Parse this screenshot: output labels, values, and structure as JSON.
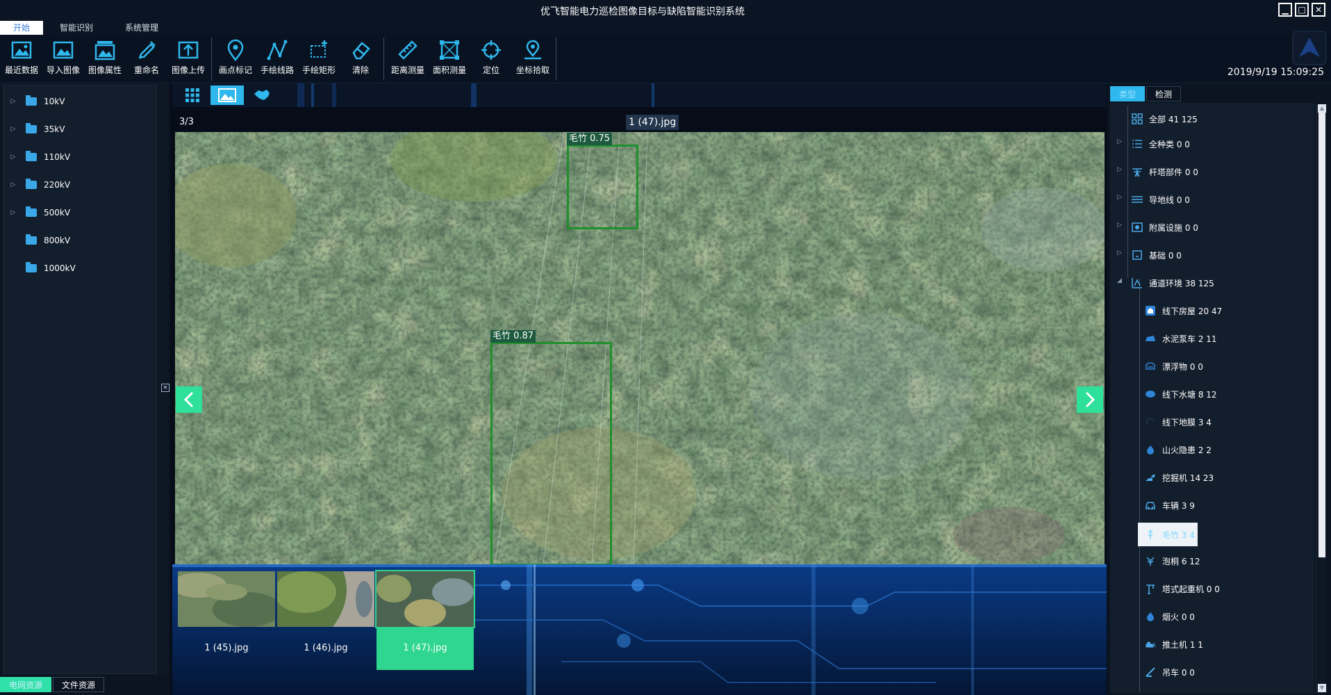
{
  "window": {
    "title": "优飞智能电力巡检图像目标与缺陷智能识别系统",
    "min": "▁",
    "max": "□",
    "close": "✕"
  },
  "menu_tabs": [
    {
      "label": "开始"
    },
    {
      "label": "智能识别"
    },
    {
      "label": "系统管理"
    }
  ],
  "ribbon": [
    {
      "label": "最近数据",
      "icon": "recent-data-icon"
    },
    {
      "label": "导入图像",
      "icon": "import-image-icon"
    },
    {
      "label": "图像属性",
      "icon": "image-properties-icon"
    },
    {
      "label": "重命名",
      "icon": "rename-icon"
    },
    {
      "label": "图像上传",
      "icon": "upload-icon"
    },
    {
      "label": "画点标记",
      "icon": "point-mark-icon"
    },
    {
      "label": "手绘线路",
      "icon": "draw-line-icon"
    },
    {
      "label": "手绘矩形",
      "icon": "draw-rect-icon"
    },
    {
      "label": "清除",
      "icon": "eraser-icon"
    },
    {
      "label": "距离测量",
      "icon": "ruler-icon"
    },
    {
      "label": "面积测量",
      "icon": "area-icon"
    },
    {
      "label": "定位",
      "icon": "crosshair-icon"
    },
    {
      "label": "坐标拾取",
      "icon": "coordinate-pick-icon"
    }
  ],
  "datetime": "2019/9/19 15:09:25",
  "voltage_tree": [
    {
      "label": "10kV",
      "expandable": true
    },
    {
      "label": "35kV",
      "expandable": true
    },
    {
      "label": "110kV",
      "expandable": true
    },
    {
      "label": "220kV",
      "expandable": true
    },
    {
      "label": "500kV",
      "expandable": true
    },
    {
      "label": "800kV",
      "expandable": false
    },
    {
      "label": "1000kV",
      "expandable": false
    }
  ],
  "left_bottom_tabs": [
    {
      "label": "电网资源"
    },
    {
      "label": "文件资源"
    }
  ],
  "viewer": {
    "page_info": "3/3",
    "filename": "1 (47).jpg",
    "detections": [
      {
        "label": "毛竹 0.75",
        "confidence": 0.75
      },
      {
        "label": "毛竹 0.87",
        "confidence": 0.87
      }
    ]
  },
  "thumbnails": [
    {
      "label": "1 (45).jpg"
    },
    {
      "label": "1 (46).jpg"
    },
    {
      "label": "1 (47).jpg",
      "selected": true
    }
  ],
  "right_tabs": [
    {
      "label": "类型"
    },
    {
      "label": "检测"
    }
  ],
  "categories": [
    {
      "label": "全部 41 125",
      "icon": "grid-icon",
      "level": 0
    },
    {
      "label": "全种类 0 0",
      "icon": "list-icon",
      "level": 0
    },
    {
      "label": "杆塔部件 0 0",
      "icon": "tower-part-icon",
      "level": 0
    },
    {
      "label": "导地线 0 0",
      "icon": "wire-icon",
      "level": 0
    },
    {
      "label": "附属设施 0 0",
      "icon": "facility-icon",
      "level": 0
    },
    {
      "label": "基础 0 0",
      "icon": "foundation-icon",
      "level": 0
    },
    {
      "label": "通道环境 38 125",
      "icon": "channel-env-icon",
      "level": 0,
      "expanded": true
    },
    {
      "label": "线下房屋 20 47",
      "icon": "house-icon",
      "level": 1
    },
    {
      "label": "水泥泵车 2 11",
      "icon": "pump-truck-icon",
      "level": 1
    },
    {
      "label": "漂浮物 0 0",
      "icon": "floater-icon",
      "level": 1
    },
    {
      "label": "线下水塘 8 12",
      "icon": "pond-icon",
      "level": 1
    },
    {
      "label": "线下地膜 3 4",
      "icon": "film-icon",
      "level": 1
    },
    {
      "label": "山火隐患 2 2",
      "icon": "fire-icon",
      "level": 1
    },
    {
      "label": "挖掘机 14 23",
      "icon": "excavator-icon",
      "level": 1
    },
    {
      "label": "车辆 3 9",
      "icon": "vehicle-icon",
      "level": 1
    },
    {
      "label": "毛竹 3 4",
      "icon": "bamboo-icon",
      "level": 1,
      "selected": true
    },
    {
      "label": "泡桐 6 12",
      "icon": "tree-icon",
      "level": 1
    },
    {
      "label": "塔式起重机 0 0",
      "icon": "crane-icon",
      "level": 1
    },
    {
      "label": "烟火 0 0",
      "icon": "smoke-icon",
      "level": 1
    },
    {
      "label": "推土机 1 1",
      "icon": "bulldozer-icon",
      "level": 1
    },
    {
      "label": "吊车 0 0",
      "icon": "truck-crane-icon",
      "level": 1
    }
  ],
  "colors": {
    "accent": "#2fb8ee",
    "green": "#2ed68f",
    "box": "#1f8f2c"
  }
}
